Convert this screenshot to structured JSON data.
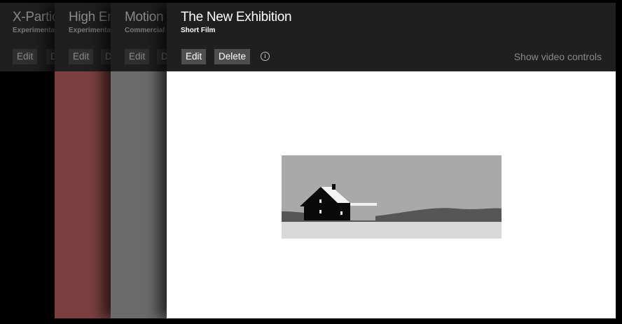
{
  "cards": [
    {
      "title": "X-Particles",
      "category": "Experimental",
      "edit_label": "Edit",
      "delete_label": "Delete",
      "body_color": "#000000"
    },
    {
      "title": "High Energy",
      "category": "Experimental",
      "edit_label": "Edit",
      "delete_label": "Delete",
      "body_color": "#7b3f3f"
    },
    {
      "title": "Motion",
      "category": "Commercial",
      "edit_label": "Edit",
      "delete_label": "Delete",
      "body_color": "#6b6b6b"
    },
    {
      "title": "The New Exhibition",
      "category": "Short Film",
      "edit_label": "Edit",
      "delete_label": "Delete",
      "info_icon": "info-icon",
      "show_video_controls_label": "Show video controls",
      "body_color": "#ffffff"
    }
  ],
  "colors": {
    "background": "#000000",
    "header": "#1f1f1f",
    "button_active": "#4e4e4e",
    "button_inactive": "#2f2f2f"
  }
}
